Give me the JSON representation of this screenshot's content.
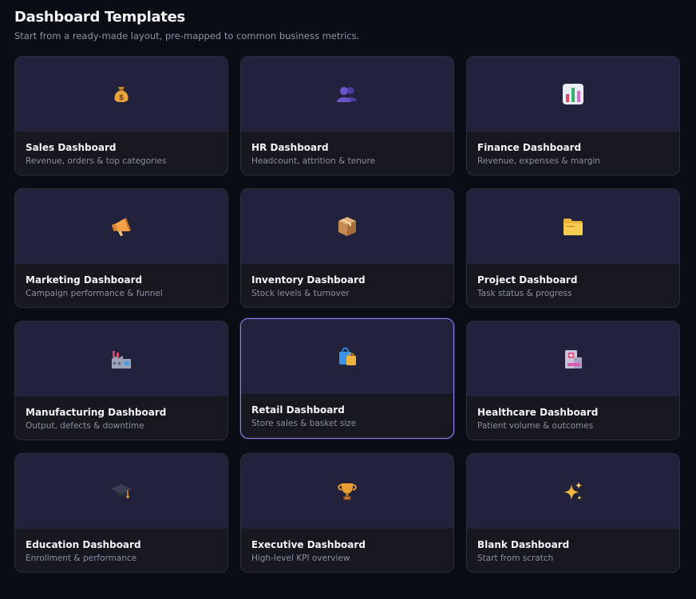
{
  "header": {
    "title": "Dashboard Templates",
    "subtitle": "Start from a ready-made layout, pre-mapped to common business metrics."
  },
  "templates": [
    {
      "name": "Sales Dashboard",
      "description": "Revenue, orders & top categories",
      "icon": "money-bag-icon",
      "selected": false
    },
    {
      "name": "HR Dashboard",
      "description": "Headcount, attrition & tenure",
      "icon": "people-icon",
      "selected": false
    },
    {
      "name": "Finance Dashboard",
      "description": "Revenue, expenses & margin",
      "icon": "bar-chart-icon",
      "selected": false
    },
    {
      "name": "Marketing Dashboard",
      "description": "Campaign performance & funnel",
      "icon": "megaphone-icon",
      "selected": false
    },
    {
      "name": "Inventory Dashboard",
      "description": "Stock levels & turnover",
      "icon": "package-icon",
      "selected": false
    },
    {
      "name": "Project Dashboard",
      "description": "Task status & progress",
      "icon": "folder-icon",
      "selected": false
    },
    {
      "name": "Manufacturing Dashboard",
      "description": "Output, defects & downtime",
      "icon": "factory-icon",
      "selected": false
    },
    {
      "name": "Retail Dashboard",
      "description": "Store sales & basket size",
      "icon": "shopping-bags-icon",
      "selected": true
    },
    {
      "name": "Healthcare Dashboard",
      "description": "Patient volume & outcomes",
      "icon": "hospital-icon",
      "selected": false
    },
    {
      "name": "Education Dashboard",
      "description": "Enrollment & performance",
      "icon": "graduation-cap-icon",
      "selected": false
    },
    {
      "name": "Executive Dashboard",
      "description": "High-level KPI overview",
      "icon": "trophy-icon",
      "selected": false
    },
    {
      "name": "Blank Dashboard",
      "description": "Start from scratch",
      "icon": "sparkles-icon",
      "selected": false
    }
  ],
  "colors": {
    "background": "#0b0d14",
    "card": "#17181f",
    "thumb": "#22223d",
    "selected_border": "#8b7cf0"
  }
}
